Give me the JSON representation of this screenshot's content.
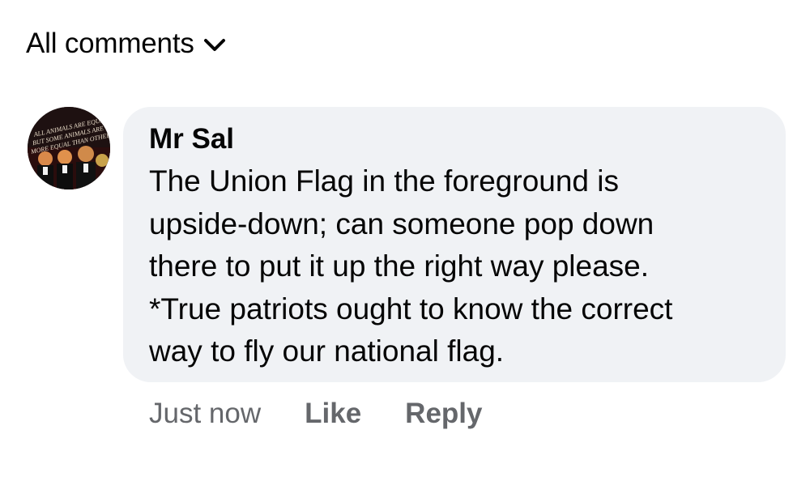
{
  "filter": {
    "label": "All comments",
    "icon": "chevron-down-icon"
  },
  "comment": {
    "author": "Mr Sal",
    "avatar": {
      "banner_lines": [
        "ALL ANIMALS ARE EQUAL",
        "BUT SOME ANIMALS ARE",
        "MORE EQUAL THAN OTHERS"
      ]
    },
    "text_lines": [
      "The Union Flag in the foreground is",
      "upside-down; can someone pop down",
      "there to put it up the right way please.",
      "*True patriots ought to know the correct",
      "way to fly our national flag."
    ],
    "timestamp": "Just now",
    "actions": {
      "like": "Like",
      "reply": "Reply"
    }
  },
  "colors": {
    "bubble_bg": "#f0f2f5",
    "meta_text": "#65676b",
    "primary_text": "#050505"
  }
}
